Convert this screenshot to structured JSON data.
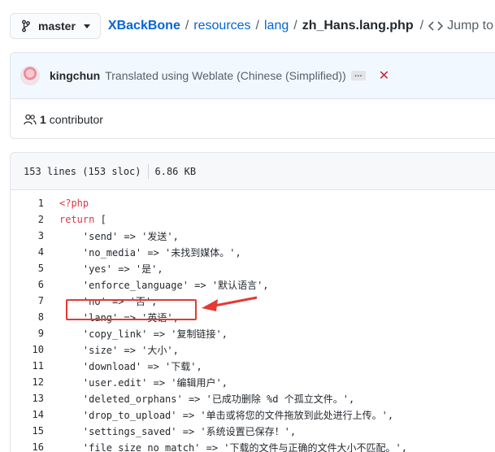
{
  "branch": {
    "label": "master"
  },
  "breadcrumb": {
    "repo": "XBackBone",
    "sep": "/",
    "path1": "resources",
    "path2": "lang",
    "file": "zh_Hans.lang.php",
    "jump_label": "Jump to"
  },
  "commit": {
    "author": "kingchun",
    "message": "Translated using Weblate (Chinese (Simplified))",
    "ellipsis": "…",
    "status_icon": "x-icon",
    "status_color": "#cb2431"
  },
  "contributors": {
    "count": "1",
    "label": "contributor"
  },
  "file_info": {
    "lines": "153 lines (153 sloc)",
    "size": "6.86 KB"
  },
  "code": [
    {
      "n": "1",
      "kw": "<?php",
      "text": ""
    },
    {
      "n": "2",
      "kw": "return",
      "text": " ["
    },
    {
      "n": "3",
      "kw": "",
      "text": "    'send' => '发送',"
    },
    {
      "n": "4",
      "kw": "",
      "text": "    'no_media' => '未找到媒体。',"
    },
    {
      "n": "5",
      "kw": "",
      "text": "    'yes' => '是',"
    },
    {
      "n": "6",
      "kw": "",
      "text": "    'enforce_language' => '默认语言',"
    },
    {
      "n": "7",
      "kw": "",
      "text": "    'no' => '否',"
    },
    {
      "n": "8",
      "kw": "",
      "text": "    'lang' => '英语',"
    },
    {
      "n": "9",
      "kw": "",
      "text": "    'copy_link' => '复制链接',"
    },
    {
      "n": "10",
      "kw": "",
      "text": "    'size' => '大小',"
    },
    {
      "n": "11",
      "kw": "",
      "text": "    'download' => '下载',"
    },
    {
      "n": "12",
      "kw": "",
      "text": "    'user.edit' => '编辑用户',"
    },
    {
      "n": "13",
      "kw": "",
      "text": "    'deleted_orphans' => '已成功删除 %d 个孤立文件。',"
    },
    {
      "n": "14",
      "kw": "",
      "text": "    'drop_to_upload' => '单击或将您的文件拖放到此处进行上传。',"
    },
    {
      "n": "15",
      "kw": "",
      "text": "    'settings_saved' => '系统设置已保存！',"
    },
    {
      "n": "16",
      "kw": "",
      "text": "    'file_size_no_match' => '下载的文件与正确的文件大小不匹配。',"
    }
  ],
  "annotation": {
    "color": "#e53935",
    "highlighted_line": 8
  }
}
